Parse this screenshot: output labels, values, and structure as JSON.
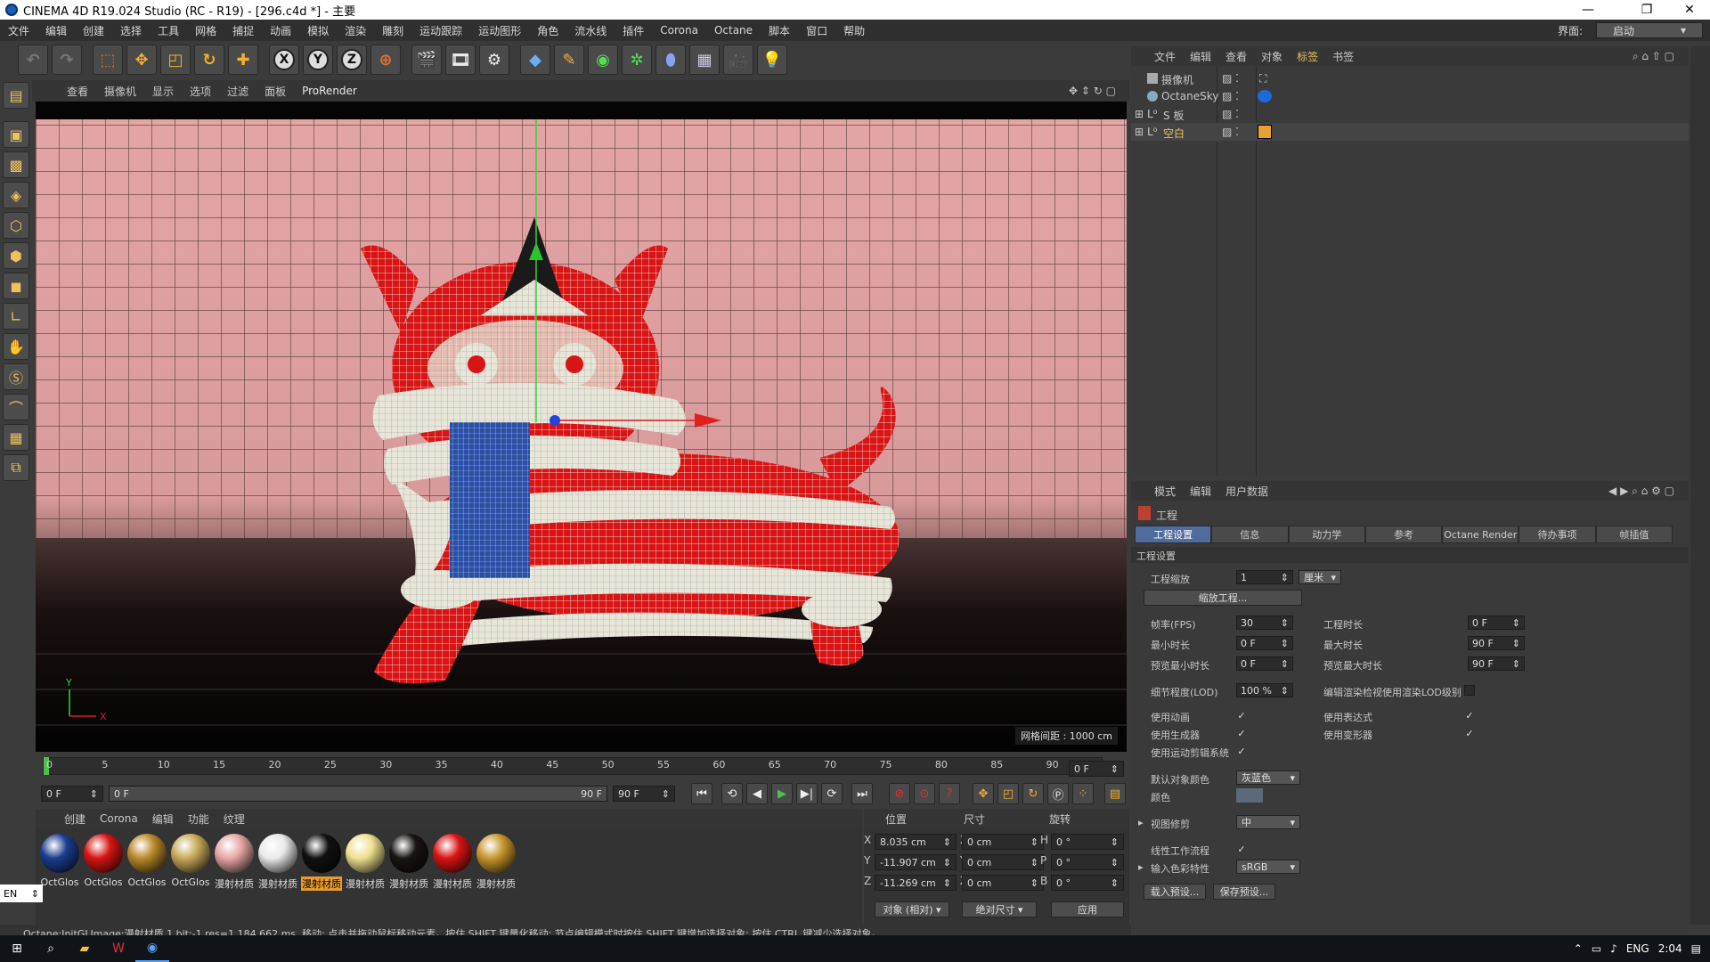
{
  "window": {
    "title": "CINEMA 4D R19.024 Studio (RC - R19) - [296.c4d *] - 主要"
  },
  "menu": [
    "文件",
    "编辑",
    "创建",
    "选择",
    "工具",
    "网格",
    "捕捉",
    "动画",
    "模拟",
    "渲染",
    "雕刻",
    "运动跟踪",
    "运动图形",
    "角色",
    "流水线",
    "插件",
    "Corona",
    "Octane",
    "脚本",
    "窗口",
    "帮助"
  ],
  "layout": {
    "label": "界面:",
    "value": "启动"
  },
  "toolbar": {
    "x": "X",
    "y": "Y",
    "z": "Z"
  },
  "viewport": {
    "menu": [
      "查看",
      "摄像机",
      "显示",
      "选项",
      "过滤",
      "面板",
      "ProRender"
    ],
    "grid_info": "网格间距 : 1000 cm",
    "axis_y": "Y",
    "axis_x": "X"
  },
  "timeline": {
    "ticks": [
      "0",
      "5",
      "10",
      "15",
      "20",
      "25",
      "30",
      "35",
      "40",
      "45",
      "50",
      "55",
      "60",
      "65",
      "70",
      "75",
      "80",
      "85",
      "90"
    ],
    "current_frame": "0 F"
  },
  "transport": {
    "start": "0 F",
    "slider_start": "0 F",
    "slider_end": "90 F",
    "end": "90 F"
  },
  "materials": {
    "menu": [
      "创建",
      "Corona",
      "编辑",
      "功能",
      "纹理"
    ],
    "items": [
      {
        "name": "OctGlos",
        "color": "#1c3d8f"
      },
      {
        "name": "OctGlos",
        "color": "#d81414"
      },
      {
        "name": "OctGlos",
        "color": "#b8892a"
      },
      {
        "name": "OctGlos",
        "color": "#c9a95a"
      },
      {
        "name": "漫射材质",
        "color": "#e8a6a6"
      },
      {
        "name": "漫射材质",
        "color": "#e9e9e9"
      },
      {
        "name": "漫射材质",
        "color": "#111111",
        "selected": true
      },
      {
        "name": "漫射材质",
        "color": "#efe08f"
      },
      {
        "name": "漫射材质",
        "color": "#1a1414"
      },
      {
        "name": "漫射材质",
        "color": "#d81414"
      },
      {
        "name": "漫射材质",
        "color": "#c7962e"
      }
    ]
  },
  "coords": {
    "headers": {
      "pos": "位置",
      "size": "尺寸",
      "rot": "旋转"
    },
    "rows": [
      {
        "a": "X",
        "pos": "8.035 cm",
        "b": "X",
        "size": "0 cm",
        "c": "H",
        "rot": "0 °"
      },
      {
        "a": "Y",
        "pos": "-11.907 cm",
        "b": "Y",
        "size": "0 cm",
        "c": "P",
        "rot": "0 °"
      },
      {
        "a": "Z",
        "pos": "-11.269 cm",
        "b": "Z",
        "size": "0 cm",
        "c": "B",
        "rot": "0 °"
      }
    ],
    "mode": "对象 (相对)",
    "size_mode": "绝对尺寸",
    "apply": "应用"
  },
  "status": "Octane:InitGLImage:漫射材质.1  bit:-1 res=1  184.662 ms.   移动: 点击并拖动鼠标移动元素。按住 SHIFT 键量化移动; 节点编辑模式时按住 SHIFT 键增加选择对象; 按住 CTRL 键减少选择对象。",
  "objects": {
    "menu": [
      "文件",
      "编辑",
      "查看",
      "对象",
      "标签",
      "书签"
    ],
    "active_menu": "标签",
    "rows": [
      {
        "name": "摄像机",
        "color": "#c8c8c8"
      },
      {
        "name": "OctaneSky",
        "color": "#c8c8c8"
      },
      {
        "name": "S 板",
        "color": "#c8c8c8"
      },
      {
        "name": "空白",
        "color": "#e8c060"
      }
    ]
  },
  "attributes": {
    "menu": [
      "模式",
      "编辑",
      "用户数据"
    ],
    "title": "工程",
    "tabs": [
      "工程设置",
      "信息",
      "动力学",
      "参考",
      "Octane Render",
      "待办事项",
      "帧插值"
    ],
    "section": "工程设置",
    "scale_label": "工程缩放",
    "scale_value": "1",
    "scale_unit": "厘米",
    "scale_button": "缩放工程...",
    "fps_label": "帧率(FPS)",
    "fps": "30",
    "proj_len_label": "工程时长",
    "proj_len": "0 F",
    "min_label": "最小时长",
    "min": "0 F",
    "max_label": "最大时长",
    "max": "90 F",
    "pmin_label": "预览最小时长",
    "pmin": "0 F",
    "pmax_label": "预览最大时长",
    "pmax": "90 F",
    "lod_label": "细节程度(LOD)",
    "lod": "100 %",
    "lod_render_label": "编辑渲染检视使用渲染LOD级别",
    "anim_label": "使用动画",
    "expr_label": "使用表达式",
    "gen_label": "使用生成器",
    "deform_label": "使用变形器",
    "mograph_label": "使用运动剪辑系统",
    "objcolor_label": "默认对象颜色",
    "objcolor": "灰蓝色",
    "color_label": "颜色",
    "clip_label": "视图修剪",
    "clip": "中",
    "linear_label": "线性工作流程",
    "input_label": "输入色彩特性",
    "input": "sRGB",
    "load": "载入预设...",
    "save": "保存预设..."
  },
  "lang": "EN",
  "taskbar": {
    "ime": "ENG",
    "time": "2:04"
  }
}
